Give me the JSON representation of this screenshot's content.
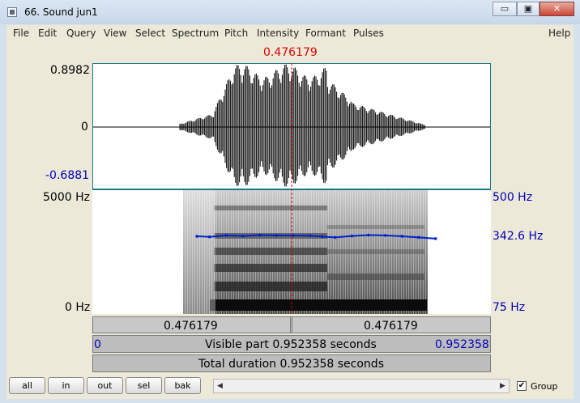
{
  "window": {
    "title": "66. Sound jun1",
    "minimize_glyph": "▭",
    "maximize_glyph": "▣",
    "close_glyph": "✕"
  },
  "menu": [
    "File",
    "Edit",
    "Query",
    "View",
    "Select",
    "Spectrum",
    "Pitch",
    "Intensity",
    "Formant",
    "Pulses"
  ],
  "menu_help": "Help",
  "cursor": {
    "time_label": "0.476179",
    "time_s": 0.476179
  },
  "waveform": {
    "max_label": "0.8982",
    "zero_label": "0",
    "min_label": "-0.6881"
  },
  "spectrogram": {
    "freq_top_label": "5000 Hz",
    "freq_bottom_label": "0 Hz",
    "pitch_top_label": "500 Hz",
    "pitch_current_label": "342.6 Hz",
    "pitch_bottom_label": "75 Hz"
  },
  "pitch_track": {
    "unit": "Hz",
    "points": [
      [
        0.25,
        340
      ],
      [
        0.28,
        338
      ],
      [
        0.32,
        343
      ],
      [
        0.36,
        341
      ],
      [
        0.4,
        344
      ],
      [
        0.44,
        343
      ],
      [
        0.48,
        342.6
      ],
      [
        0.52,
        342
      ],
      [
        0.55,
        339
      ],
      [
        0.58,
        336
      ],
      [
        0.62,
        341
      ],
      [
        0.66,
        344
      ],
      [
        0.7,
        343
      ],
      [
        0.74,
        340
      ],
      [
        0.78,
        336
      ],
      [
        0.82,
        332
      ]
    ]
  },
  "time_bars": {
    "left_part": "0.476179",
    "right_part": "0.476179",
    "visible_start": "0",
    "visible_label": "Visible part 0.952358 seconds",
    "visible_end": "0.952358",
    "total_label": "Total duration 0.952358 seconds"
  },
  "bottom": {
    "buttons": [
      "all",
      "in",
      "out",
      "sel",
      "bak"
    ],
    "scroll_left": "◀",
    "scroll_right": "▶",
    "group_checked": "✔",
    "group_label": "Group"
  },
  "colors": {
    "cursor": "#dd0000",
    "pitch": "#0022cc",
    "pitch_labels": "#0000b8"
  }
}
